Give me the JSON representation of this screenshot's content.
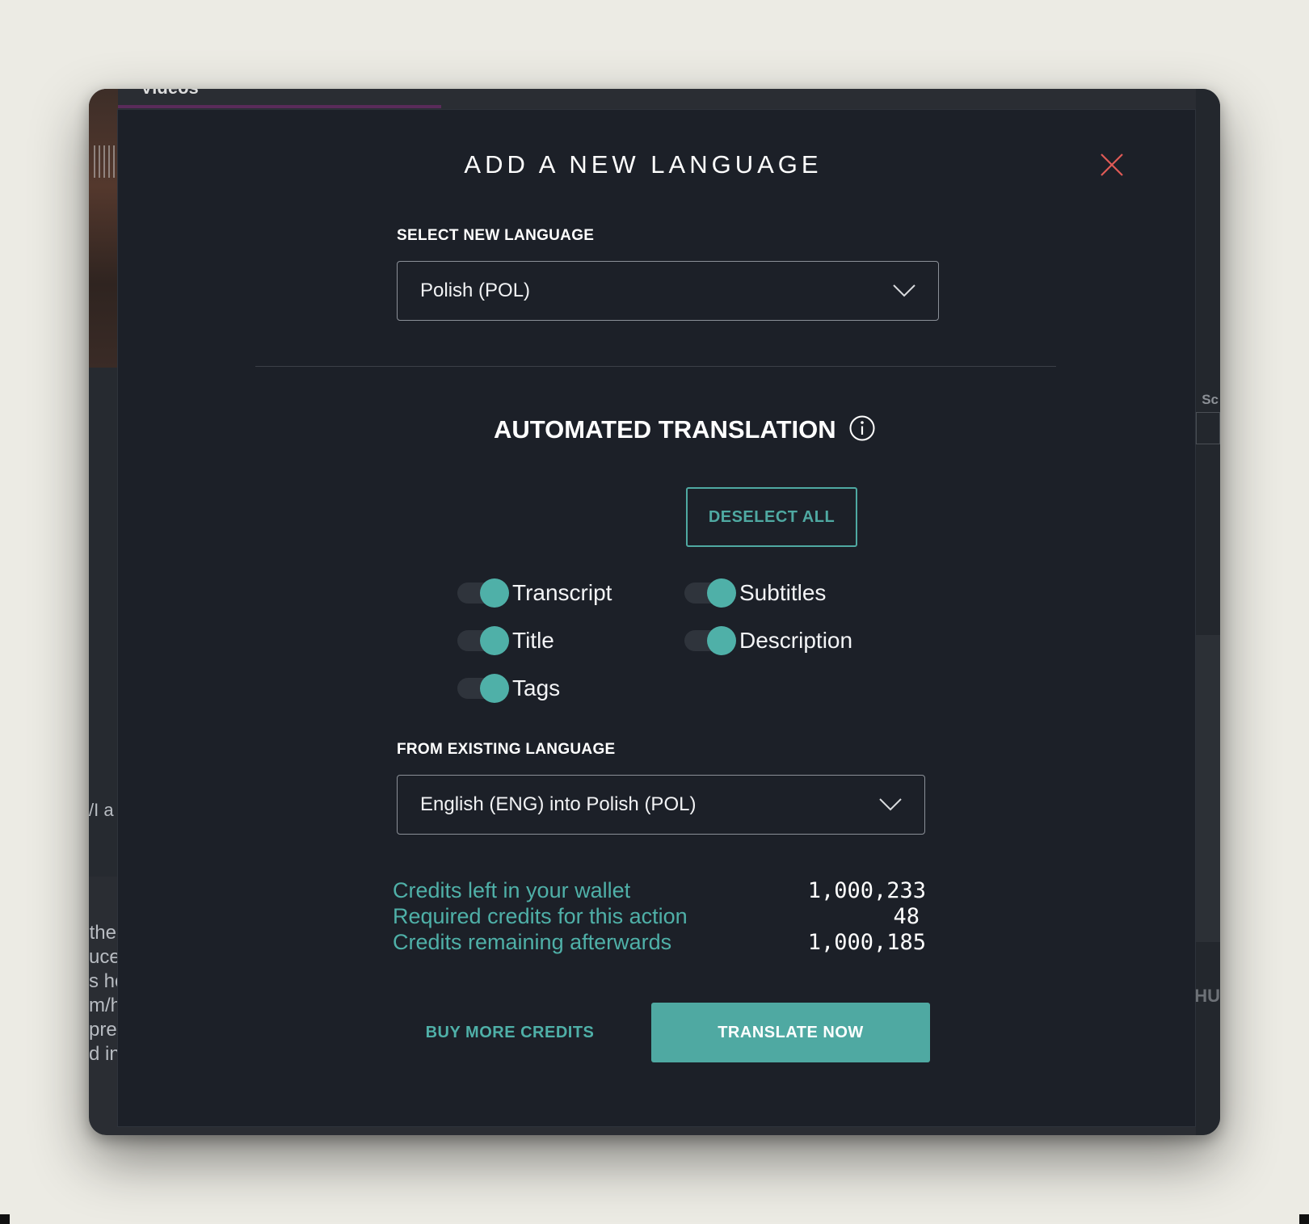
{
  "background": {
    "top_title": "Videos",
    "left_fragment_a": "/I a",
    "left_text_lines": [
      "the",
      "uce",
      "s ho",
      "m/h",
      "prea",
      "d in"
    ],
    "right_fragment_sc": "Sc",
    "right_fragment_hu": "HU"
  },
  "modal": {
    "title": "ADD A NEW LANGUAGE",
    "close_icon": "close-icon",
    "select_new_language": {
      "label": "SELECT NEW LANGUAGE",
      "value": "Polish (POL)"
    },
    "automated_translation": {
      "title": "AUTOMATED TRANSLATION",
      "info_icon": "info-icon",
      "deselect_all_label": "DESELECT ALL",
      "toggles": [
        {
          "label": "Transcript",
          "on": true
        },
        {
          "label": "Subtitles",
          "on": true
        },
        {
          "label": "Title",
          "on": true
        },
        {
          "label": "Description",
          "on": true
        },
        {
          "label": "Tags",
          "on": true
        }
      ]
    },
    "from_existing_language": {
      "label": "FROM EXISTING LANGUAGE",
      "value": "English (ENG) into Polish (POL)"
    },
    "credits": [
      {
        "label": "Credits left in your wallet",
        "value": "1,000,233"
      },
      {
        "label": "Required credits for this action",
        "value": "48"
      },
      {
        "label": "Credits remaining afterwards",
        "value": "1,000,185"
      }
    ],
    "buy_more_label": "BUY MORE CREDITS",
    "translate_now_label": "TRANSLATE NOW"
  },
  "colors": {
    "accent": "#4fa9a2",
    "modal_bg": "#1c2028",
    "close": "#e05a56"
  }
}
